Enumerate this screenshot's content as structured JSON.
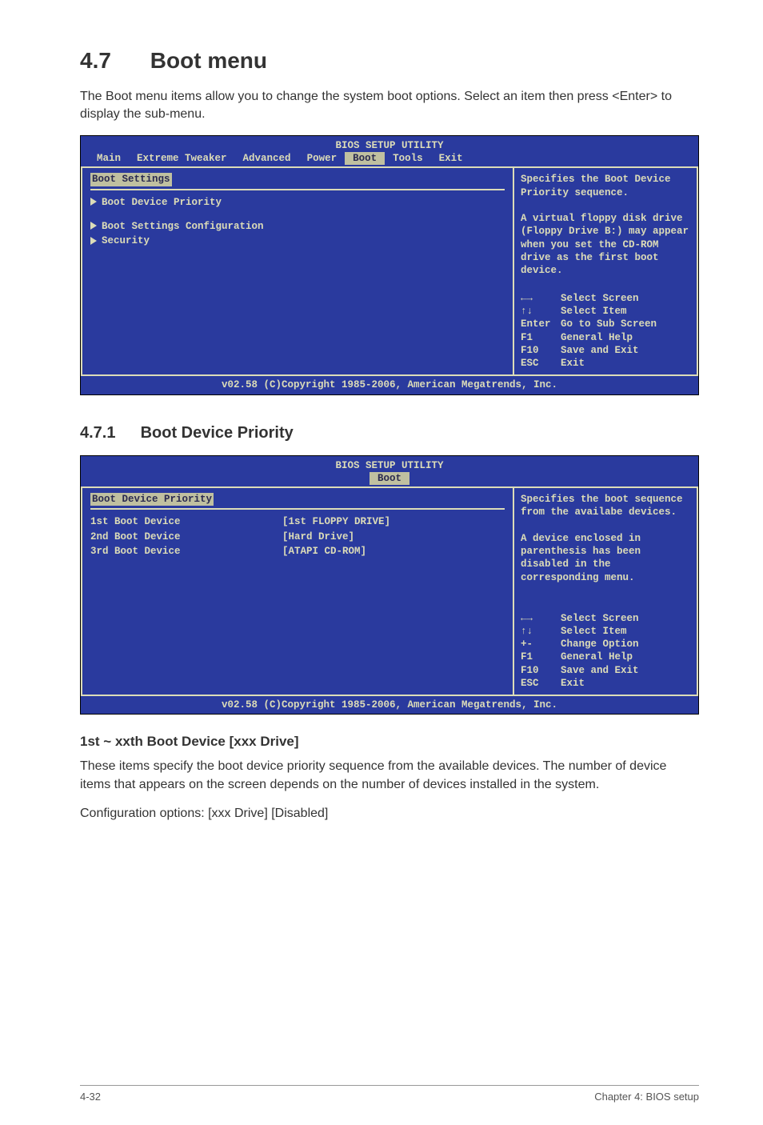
{
  "heading": {
    "num": "4.7",
    "title": "Boot menu"
  },
  "intro": "The Boot menu items allow you to change the system boot options. Select an item then press <Enter> to display the sub-menu.",
  "bios1": {
    "header": "BIOS SETUP UTILITY",
    "tabs": [
      "Main",
      "Extreme Tweaker",
      "Advanced",
      "Power",
      "Boot",
      "Tools",
      "Exit"
    ],
    "section_title": "Boot Settings",
    "items": [
      "Boot Device Priority",
      "Boot Settings Configuration",
      "Security"
    ],
    "help": "Specifies the Boot Device Priority sequence.\n\nA virtual floppy disk drive (Floppy Drive B:) may appear when you set the CD-ROM drive as the first boot device.",
    "keys": [
      {
        "k": "←→",
        "v": "Select Screen"
      },
      {
        "k": "↑↓",
        "v": "Select Item"
      },
      {
        "k": "Enter",
        "v": "Go to Sub Screen"
      },
      {
        "k": "F1",
        "v": "General Help"
      },
      {
        "k": "F10",
        "v": "Save and Exit"
      },
      {
        "k": "ESC",
        "v": "Exit"
      }
    ],
    "footer": "v02.58 (C)Copyright 1985-2006, American Megatrends, Inc."
  },
  "sub": {
    "num": "4.7.1",
    "title": "Boot Device Priority"
  },
  "bios2": {
    "header": "BIOS SETUP UTILITY",
    "tabs": [
      "Boot"
    ],
    "section_title": "Boot Device Priority",
    "rows": [
      {
        "label": "1st Boot Device",
        "value": "[1st FLOPPY DRIVE]"
      },
      {
        "label": "2nd Boot Device",
        "value": "[Hard Drive]"
      },
      {
        "label": "3rd Boot Device",
        "value": "[ATAPI CD-ROM]"
      }
    ],
    "help": "Specifies the boot sequence from the availabe devices.\n\nA device enclosed in parenthesis has been disabled in the corresponding menu.",
    "keys": [
      {
        "k": "←→",
        "v": "Select Screen"
      },
      {
        "k": "↑↓",
        "v": "Select Item"
      },
      {
        "k": "+-",
        "v": "Change Option"
      },
      {
        "k": "F1",
        "v": "General Help"
      },
      {
        "k": "F10",
        "v": "Save and Exit"
      },
      {
        "k": "ESC",
        "v": "Exit"
      }
    ],
    "footer": "v02.58 (C)Copyright 1985-2006, American Megatrends, Inc."
  },
  "h3": "1st ~ xxth Boot Device [xxx Drive]",
  "para1": "These items specify the boot device priority sequence from the available devices. The number of device items that appears on the screen depends on the number of devices installed in the system.",
  "para2": "Configuration options: [xxx Drive] [Disabled]",
  "footer": {
    "left": "4-32",
    "right": "Chapter 4: BIOS setup"
  }
}
